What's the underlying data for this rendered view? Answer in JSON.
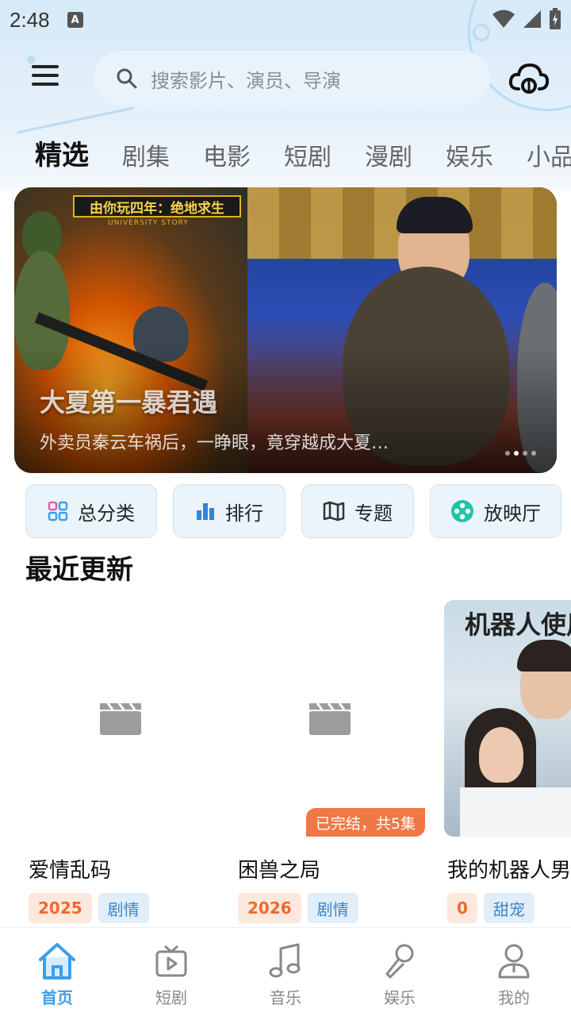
{
  "status_bar": {
    "time": "2:48",
    "badge": "A"
  },
  "search": {
    "placeholder": "搜索影片、演员、导演"
  },
  "tabs": [
    {
      "label": "精选",
      "active": true
    },
    {
      "label": "剧集"
    },
    {
      "label": "电影"
    },
    {
      "label": "短剧"
    },
    {
      "label": "漫剧"
    },
    {
      "label": "娱乐"
    },
    {
      "label": "小品"
    }
  ],
  "banner": {
    "poster_badge": "由你玩四年：绝地求生",
    "poster_sub": "UNIVERSITY STORY",
    "title": "大夏第一暴君遇",
    "description": "外卖员秦云车祸后，一睁眼，竟穿越成大夏…",
    "dots": 3,
    "active_dot": 1
  },
  "quick_actions": [
    {
      "label": "总分类",
      "icon": "grid-icon"
    },
    {
      "label": "排行",
      "icon": "bar-chart-icon"
    },
    {
      "label": "专题",
      "icon": "map-icon"
    },
    {
      "label": "放映厅",
      "icon": "film-reel-icon"
    }
  ],
  "section": {
    "title": "最近更新"
  },
  "cards": [
    {
      "name": "爱情乱码",
      "year": "2025",
      "genre": "剧情",
      "badge": ""
    },
    {
      "name": "困兽之局",
      "year": "2026",
      "genre": "剧情",
      "badge": "已完结，共5集"
    },
    {
      "name": "我的机器人男友",
      "year": "0",
      "genre": "甜宠",
      "badge": "",
      "poster_text": "机器人使用"
    }
  ],
  "bottom_nav": [
    {
      "label": "首页",
      "icon": "home-icon",
      "active": true
    },
    {
      "label": "短剧",
      "icon": "tv-play-icon"
    },
    {
      "label": "音乐",
      "icon": "music-note-icon"
    },
    {
      "label": "娱乐",
      "icon": "microphone-icon"
    },
    {
      "label": "我的",
      "icon": "user-icon"
    }
  ],
  "colors": {
    "accent": "#3aa0ea",
    "year_tag": "#f06a2b",
    "genre_tag": "#3b87c9",
    "finish_badge": "#f07846"
  }
}
